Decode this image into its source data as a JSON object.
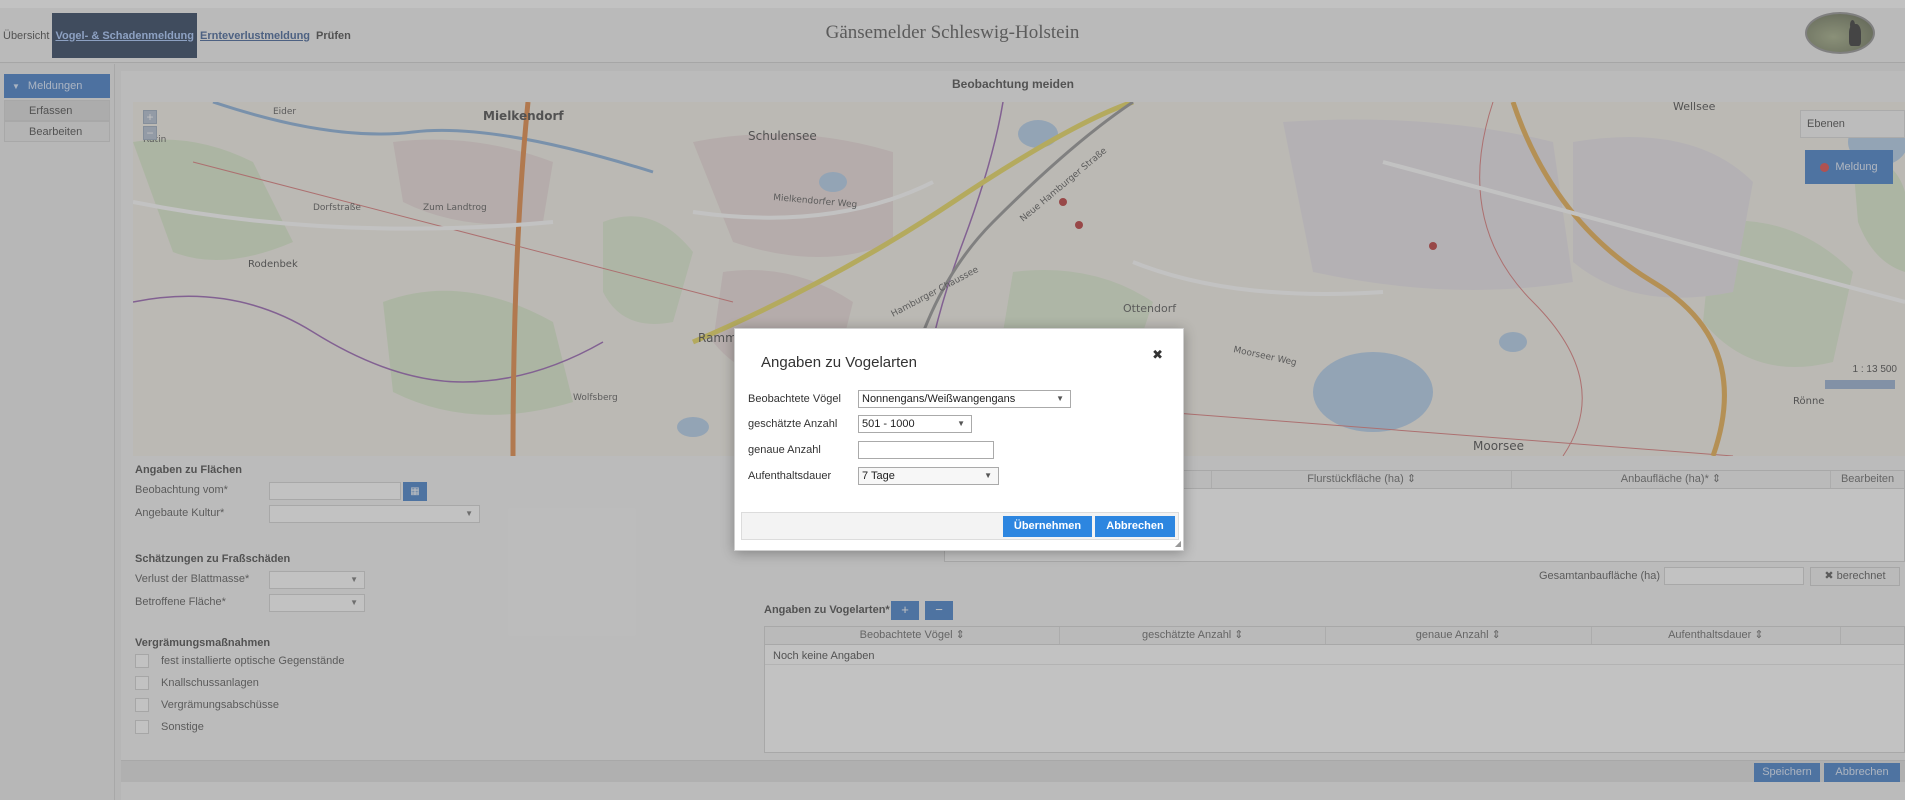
{
  "header": {
    "app_title": "Gänsemelder Schleswig-Holstein",
    "nav": [
      {
        "label": "Übersicht"
      },
      {
        "label": "Vogel- & Schadenmeldung"
      },
      {
        "label": "Ernteverlustmeldung"
      },
      {
        "label": "Prüfen"
      }
    ]
  },
  "sidebar": {
    "heading": "Meldungen",
    "items": [
      {
        "label": "Erfassen"
      },
      {
        "label": "Bearbeiten"
      }
    ]
  },
  "main": {
    "panel_title": "Beobachtung meiden",
    "map": {
      "zoom_in": "+",
      "zoom_out": "−",
      "layers_label": "Ebenen",
      "meldung_label": "Meldung",
      "scale_text": "1 : 13 500",
      "labels": [
        "Mielkendorf",
        "Schulensee",
        "Rodenbek",
        "Ramm",
        "Moorsee",
        "Wellsee",
        "Rönne",
        "Hamburger Chaussee",
        "Neue Hamburger Straße",
        "Mielkendorfer Weg",
        "Dorfstraße",
        "Rutin",
        "Zum Landtrog",
        "Eider",
        "Moorseer Weg",
        "Wolfsberg",
        "Ottendorf"
      ]
    },
    "flaechen": {
      "title": "Angaben zu Flächen",
      "beobachtung_label": "Beobachtung vom*",
      "kultur_label": "Angebaute Kultur*"
    },
    "fraszschaeden": {
      "title": "Schätzungen zu Fraßschäden",
      "verlust_label": "Verlust der Blattmasse*",
      "flaeche_label": "Betroffene Fläche*"
    },
    "vergraemung": {
      "title": "Vergrämungsmaßnahmen",
      "options": [
        {
          "label": "fest installierte optische Gegenstände"
        },
        {
          "label": "Knallschussanlagen"
        },
        {
          "label": "Vergrämungsabschüsse"
        },
        {
          "label": "Sonstige"
        }
      ]
    },
    "flurstuecke_table": {
      "columns": [
        "Flurstückfläche (ha) ⇕",
        "Anbaufläche (ha)* ⇕",
        "Bearbeiten"
      ],
      "gesamt_label": "Gesamtanbaufläche (ha)",
      "berechnet_label": "✖ berechnet"
    },
    "vogelarten_table": {
      "title": "Angaben zu Vogelarten*",
      "add": "+",
      "remove": "−",
      "columns": [
        "Beobachtete Vögel ⇕",
        "geschätzte Anzahl ⇕",
        "genaue Anzahl ⇕",
        "Aufenthaltsdauer ⇕"
      ],
      "empty_text": "Noch keine Angaben"
    },
    "footer": {
      "save_label": "Speichern",
      "cancel_label": "Abbrechen"
    }
  },
  "dialog": {
    "title": "Angaben zu Vogelarten",
    "close": "✖",
    "fields": {
      "voegel_label": "Beobachtete Vögel",
      "voegel_value": "Nonnengans/Weißwangengans",
      "geschaetzt_label": "geschätzte Anzahl",
      "geschaetzt_value": "501 - 1000",
      "genau_label": "genaue Anzahl",
      "genau_value": "",
      "dauer_label": "Aufenthaltsdauer",
      "dauer_value": "7 Tage"
    },
    "ok_label": "Übernehmen",
    "cancel_label": "Abbrechen"
  },
  "colors": {
    "accent": "#2d6fc3",
    "button": "#2d86e0",
    "nav_active": "#13294a",
    "map_marker": "#b22222"
  }
}
